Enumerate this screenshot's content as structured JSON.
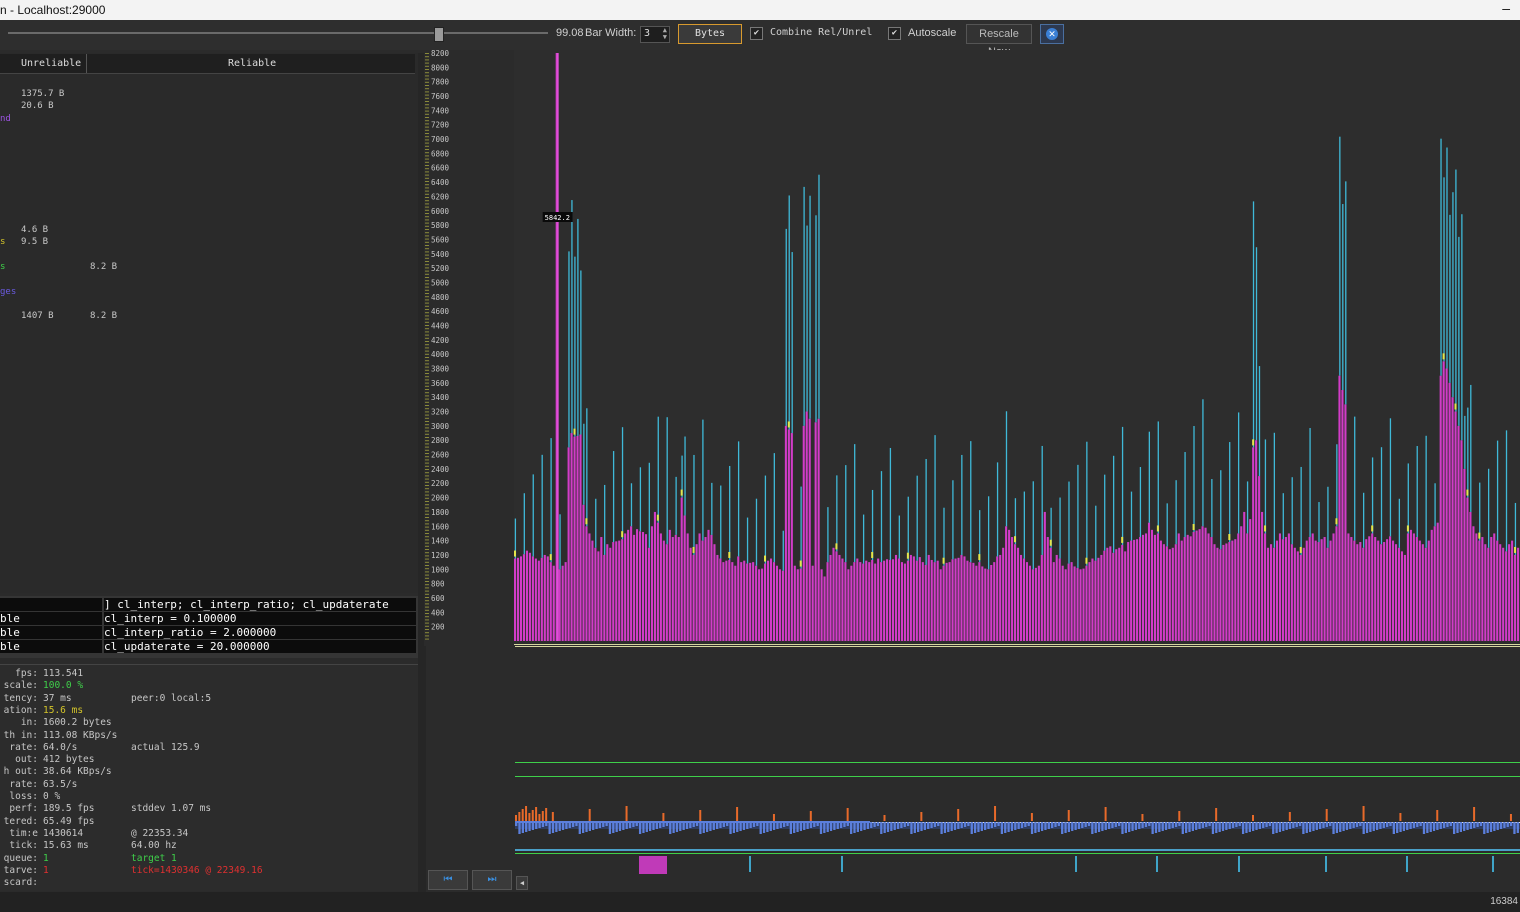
{
  "window": {
    "title": "n - Localhost:29000",
    "minimize_glyph": "–"
  },
  "toolbar": {
    "slider_value": "99.08",
    "bar_width_label": "Bar Width:",
    "bar_width_value": "3",
    "bytes_button": "Bytes",
    "combine_label": "Combine Rel/Unrel",
    "combine_checked": true,
    "autoscale_label": "Autoscale",
    "autoscale_checked": true,
    "rescale_button": "Rescale Now"
  },
  "left_panel": {
    "headers": [
      "Unreliable",
      "Reliable"
    ],
    "rows": [
      {
        "unreliable": "1375.7 B",
        "reliable": ""
      },
      {
        "unreliable": "20.6 B",
        "reliable": ""
      },
      {
        "unreliable": "4.6 B",
        "reliable": ""
      },
      {
        "unreliable": "9.5 B",
        "reliable": ""
      },
      {
        "unreliable": "",
        "reliable": "8.2 B"
      },
      {
        "unreliable": "1407 B",
        "reliable": "8.2 B"
      }
    ],
    "fragments": [
      "nd",
      "s",
      "s",
      "ges"
    ]
  },
  "console": {
    "lines": [
      {
        "label": "",
        "text": "] cl_interp; cl_interp_ratio; cl_updaterate"
      },
      {
        "label": "ble",
        "text": "cl_interp = 0.100000"
      },
      {
        "label": "ble",
        "text": "cl_interp_ratio = 2.000000"
      },
      {
        "label": "ble",
        "text": "cl_updaterate = 20.000000"
      }
    ]
  },
  "stats": [
    {
      "label": "fps:",
      "value": "113.541",
      "extra": "",
      "vcolor": "#c6c6c6"
    },
    {
      "label": "scale:",
      "value": "100.0 %",
      "extra": "",
      "vcolor": "#3fd04a"
    },
    {
      "label": "tency:",
      "value": "37 ms",
      "extra": "peer:0 local:5",
      "vcolor": "#c6c6c6"
    },
    {
      "label": "ation:",
      "value": "15.6 ms",
      "extra": "",
      "vcolor": "#d4c52a"
    },
    {
      "label": "in:",
      "value": "1600.2 bytes",
      "extra": "",
      "vcolor": "#c6c6c6"
    },
    {
      "label": "th in:",
      "value": "113.08 KBps/s",
      "extra": "",
      "vcolor": "#c6c6c6"
    },
    {
      "label": "rate:",
      "value": "64.0/s",
      "extra": "actual 125.9",
      "vcolor": "#c6c6c6"
    },
    {
      "label": "out:",
      "value": "412 bytes",
      "extra": "",
      "vcolor": "#c6c6c6"
    },
    {
      "label": "h out:",
      "value": "38.64 KBps/s",
      "extra": "",
      "vcolor": "#c6c6c6"
    },
    {
      "label": "rate:",
      "value": "63.5/s",
      "extra": "",
      "vcolor": "#c6c6c6"
    },
    {
      "label": "loss:",
      "value": "0 %",
      "extra": "",
      "vcolor": "#c6c6c6"
    },
    {
      "label": "perf:",
      "value": "189.5 fps",
      "extra": "stddev 1.07 ms",
      "vcolor": "#c6c6c6"
    },
    {
      "label": "tered:",
      "value": "65.49 fps",
      "extra": "",
      "vcolor": "#c6c6c6"
    },
    {
      "label": "tim:e",
      "value": "1430614",
      "extra": "@ 22353.34",
      "vcolor": "#c6c6c6"
    },
    {
      "label": "tick:",
      "value": "15.63 ms",
      "extra": "64.00 hz",
      "vcolor": "#c6c6c6"
    },
    {
      "label": "queue:",
      "value": "1",
      "extra": "target 1",
      "vcolor": "#3fd04a"
    },
    {
      "label": "tarve:",
      "value": "1",
      "extra": "tick=1430346 @ 22349.16",
      "vcolor": "#e03030"
    },
    {
      "label": "scard:",
      "value": "",
      "extra": "",
      "vcolor": "#c6c6c6"
    }
  ],
  "chart_data": {
    "type": "bar",
    "title": "",
    "ylim": [
      0,
      8200
    ],
    "yticks": [
      200,
      400,
      600,
      800,
      1000,
      1200,
      1400,
      1600,
      1800,
      2000,
      2200,
      2400,
      2600,
      2800,
      3000,
      3200,
      3400,
      3600,
      3800,
      4000,
      4200,
      4400,
      4600,
      4800,
      5000,
      5200,
      5400,
      5600,
      5800,
      6000,
      6200,
      6400,
      6600,
      6800,
      7000,
      7200,
      7400,
      7600,
      7800,
      8000,
      8200
    ],
    "marker_label": "5842.2",
    "marker_value": 5842.2,
    "series": [
      {
        "name": "",
        "color": "#d23cc8",
        "values": [
          1150,
          1160,
          1180,
          1210,
          1260,
          1230,
          1180,
          1150,
          1120,
          1160,
          1200,
          1180,
          1100,
          1050,
          8200,
          1000,
          1050,
          1100,
          2700,
          2900,
          2850,
          2860,
          2880,
          1900,
          1600,
          1500,
          1400,
          1300,
          1250,
          1450,
          1200,
          1350,
          1300,
          1380,
          1390,
          1400,
          1420,
          1500,
          1550,
          1600,
          1480,
          1560,
          1530,
          1520,
          1490,
          1300,
          1600,
          1800,
          1650,
          1500,
          1400,
          1350,
          1550,
          1450,
          1480,
          1450,
          2000,
          1750,
          1500,
          1300,
          1200,
          1350,
          1500,
          1400,
          1450,
          1550,
          1480,
          1350,
          1200,
          1150,
          1100,
          1120,
          1130,
          1100,
          1050,
          1180,
          1100,
          1120,
          1080,
          1090,
          1100,
          1050,
          1000,
          1010,
          1080,
          1120,
          1150,
          1100,
          1050,
          1000,
          980,
          3000,
          2950,
          2900,
          1050,
          1000,
          1010,
          3000,
          3200,
          3100,
          1050,
          3050,
          3100,
          1000,
          900,
          1100,
          1200,
          1300,
          1250,
          1200,
          1150,
          1100,
          1000,
          1050,
          1100,
          1150,
          1100,
          1080,
          1120,
          1100,
          1130,
          1080,
          1150,
          1100,
          1120,
          1140,
          1130,
          1140,
          1200,
          1150,
          1100,
          1080,
          1120,
          1200,
          1180,
          1120,
          1170,
          1100,
          1060,
          1200,
          1130,
          1100,
          1120,
          1000,
          1050,
          1090,
          1100,
          1140,
          1150,
          1160,
          1200,
          1180,
          1120,
          1100,
          1090,
          1050,
          1100,
          1040,
          1010,
          1000,
          1060,
          1100,
          1180,
          1200,
          1300,
          1600,
          1550,
          1450,
          1350,
          1300,
          1200,
          1150,
          1100,
          1050,
          1000,
          1020,
          1050,
          1200,
          1800,
          1450,
          1300,
          1100,
          1200,
          1150,
          1050,
          1000,
          1080,
          1100,
          1040,
          1020,
          1000,
          1010,
          1050,
          1100,
          1150,
          1120,
          1160,
          1200,
          1260,
          1300,
          1320,
          1230,
          1280,
          1300,
          1340,
          1250,
          1380,
          1400,
          1410,
          1420,
          1450,
          1480,
          1500,
          1650,
          1550,
          1480,
          1500,
          1400,
          1350,
          1320,
          1280,
          1300,
          1350,
          1500,
          1400,
          1450,
          1480,
          1460,
          1520,
          1540,
          1560,
          1600,
          1580,
          1500,
          1450,
          1350,
          1300,
          1280,
          1340,
          1360,
          1380,
          1400,
          1420,
          1500,
          1600,
          1800,
          1500,
          1700,
          2700,
          2800,
          2300,
          1800,
          1500,
          1300,
          1350,
          1300,
          1400,
          1500,
          1420,
          1450,
          1500,
          1350,
          1300,
          1250,
          1200,
          1300,
          1400,
          1450,
          1500,
          1400,
          1380,
          1420,
          1450,
          1300,
          1400,
          1500,
          1600,
          3700,
          3500,
          3300,
          1500,
          1450,
          1400,
          1350,
          1380,
          1300,
          1420,
          1460,
          1500,
          1450,
          1400,
          1350,
          1380,
          1420,
          1460,
          1400,
          1350,
          1300,
          1250,
          1200,
          1500,
          1550,
          1500,
          1450,
          1400,
          1350,
          1300,
          1400,
          1550,
          1600,
          1650,
          3700,
          3900,
          3800,
          3600,
          3400,
          3200,
          3000,
          2800,
          2400,
          2000,
          1800,
          1600,
          1500,
          1400,
          1450,
          1350,
          1300,
          1450,
          1500,
          1400,
          1350,
          1300,
          1250,
          1350,
          1400,
          1200,
          1300
        ],
        "secondary": [
          {
            "name": "",
            "color": "#3fb9d8"
          },
          {
            "name": "",
            "color": "#e6e64a"
          }
        ]
      }
    ]
  }
}
